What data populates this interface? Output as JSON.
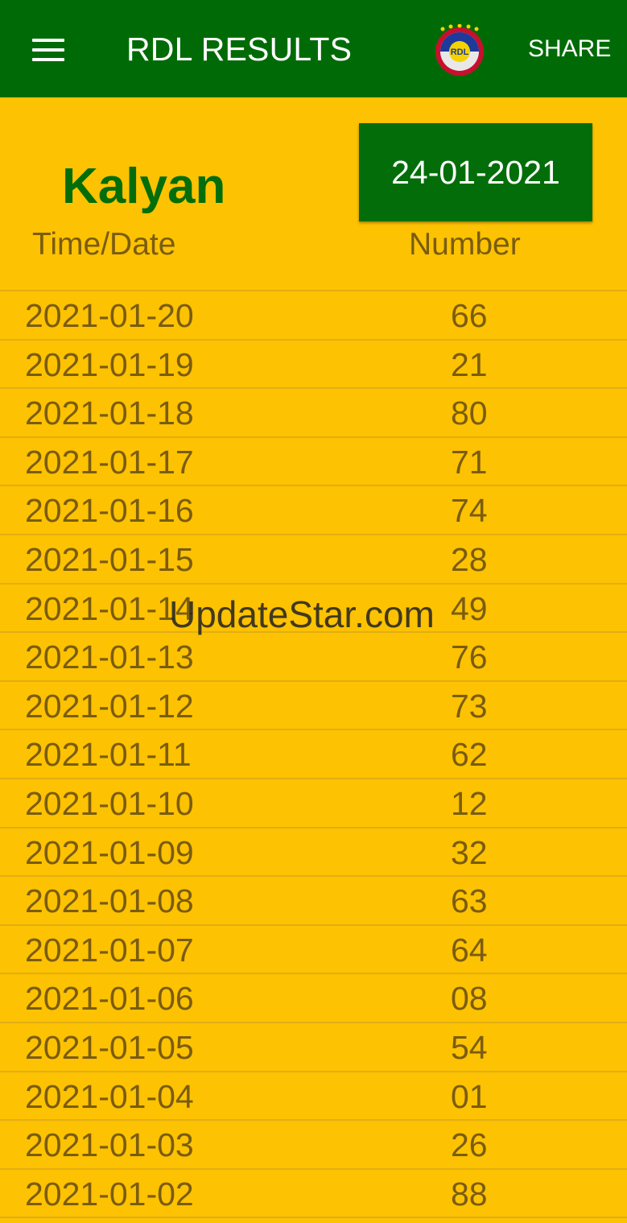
{
  "app_bar": {
    "title": "RDL RESULTS",
    "share_label": "SHARE",
    "menu_icon": "hamburger-menu-icon",
    "logo_text": "RDL"
  },
  "market": {
    "name": "Kalyan",
    "selected_date": "24-01-2021"
  },
  "table": {
    "headers": [
      "Time/Date",
      "Number"
    ],
    "rows": [
      {
        "date": "2021-01-20",
        "number": "66"
      },
      {
        "date": "2021-01-19",
        "number": "21"
      },
      {
        "date": "2021-01-18",
        "number": "80"
      },
      {
        "date": "2021-01-17",
        "number": "71"
      },
      {
        "date": "2021-01-16",
        "number": "74"
      },
      {
        "date": "2021-01-15",
        "number": "28"
      },
      {
        "date": "2021-01-14",
        "number": "49"
      },
      {
        "date": "2021-01-13",
        "number": "76"
      },
      {
        "date": "2021-01-12",
        "number": "73"
      },
      {
        "date": "2021-01-11",
        "number": "62"
      },
      {
        "date": "2021-01-10",
        "number": "12"
      },
      {
        "date": "2021-01-09",
        "number": "32"
      },
      {
        "date": "2021-01-08",
        "number": "63"
      },
      {
        "date": "2021-01-07",
        "number": "64"
      },
      {
        "date": "2021-01-06",
        "number": "08"
      },
      {
        "date": "2021-01-05",
        "number": "54"
      },
      {
        "date": "2021-01-04",
        "number": "01"
      },
      {
        "date": "2021-01-03",
        "number": "26"
      },
      {
        "date": "2021-01-02",
        "number": "88"
      }
    ]
  },
  "watermark": "UpdateStar.com",
  "colors": {
    "app_bar": "#006B06",
    "background": "#FDC201",
    "accent_green": "#036E09",
    "text_brown": "#7A5C10"
  }
}
